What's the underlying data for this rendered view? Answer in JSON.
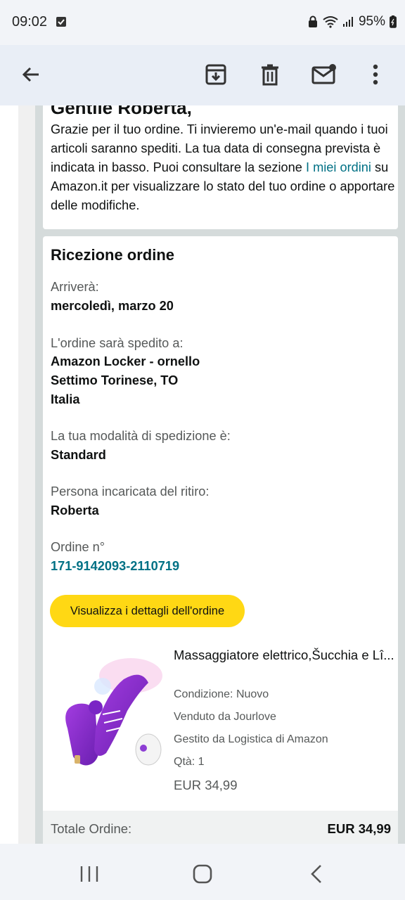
{
  "status": {
    "time": "09:02",
    "battery": "95%"
  },
  "appbar": {
    "icons": [
      "back-arrow-icon",
      "archive-icon",
      "delete-icon",
      "mark-unread-icon",
      "more-vert-icon"
    ]
  },
  "email": {
    "greeting": "Gentile Roberta,",
    "intro_before_link": "Grazie per il tuo ordine. Ti invieremo un'e-mail quando i tuoi articoli saranno spediti. La tua data di consegna prevista è indicata in basso. Puoi consultare la sezione ",
    "intro_link": "I miei ordini",
    "intro_after_link": " su Amazon.it per visualizzare lo stato del tuo ordine o apportare delle modifiche.",
    "section_title": "Ricezione ordine",
    "arrival_label": "Arriverà:",
    "arrival_value": "mercoledì, marzo 20",
    "ship_label": "L'ordine sarà spedito a:",
    "ship_line1": "Amazon Locker - ornello",
    "ship_line2": "Settimo Torinese, TO",
    "ship_line3": "Italia",
    "method_label": "La tua modalità di spedizione è:",
    "method_value": "Standard",
    "pickup_label": "Persona incaricata del ritiro:",
    "pickup_value": "Roberta",
    "order_label": "Ordine n°",
    "order_number": "171-9142093-2110719",
    "details_button": "Visualizza i dettagli dell'ordine",
    "product": {
      "title": "Massaggiatore elettrico,Šucchia e Lî...",
      "condition": "Condizione: Nuovo",
      "seller": "Venduto da Jourlove",
      "fulfilled": "Gestito da Logistica di Amazon",
      "qty": "Qtà: 1",
      "price": "EUR 34,99"
    },
    "total_label": "Totale Ordine:",
    "total_value": "EUR 34,99"
  },
  "colors": {
    "link": "#007185",
    "button": "#ffd814",
    "appbar": "#e9eef6"
  }
}
